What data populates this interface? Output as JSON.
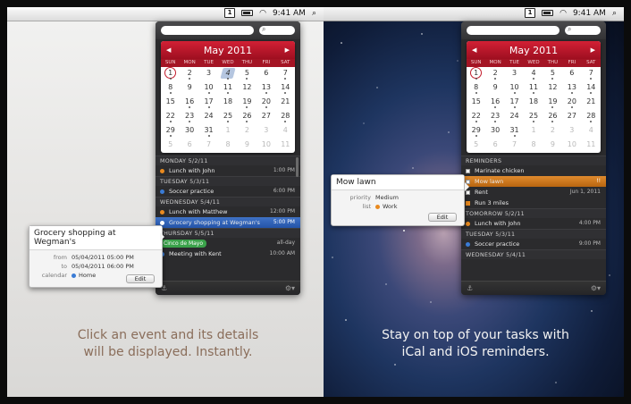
{
  "menubar": {
    "calendar_icon_text": "1",
    "time": "9:41 AM"
  },
  "calendar": {
    "month_title": "May 2011",
    "prev": "◀",
    "next": "▶",
    "weekdays": [
      "SUN",
      "MON",
      "TUE",
      "WED",
      "THU",
      "FRI",
      "SAT"
    ],
    "days": [
      "1",
      "2",
      "3",
      "4",
      "5",
      "6",
      "7",
      "8",
      "9",
      "10",
      "11",
      "12",
      "13",
      "14",
      "15",
      "16",
      "17",
      "18",
      "19",
      "20",
      "21",
      "22",
      "23",
      "24",
      "25",
      "26",
      "27",
      "28",
      "29",
      "30",
      "31",
      "1",
      "2",
      "3",
      "4",
      "5",
      "6",
      "7",
      "8",
      "9",
      "10",
      "11"
    ]
  },
  "left": {
    "agenda": {
      "monday_header": "MONDAY 5/2/11",
      "lunch_john": "Lunch with John",
      "lunch_john_time": "1:00 PM",
      "tuesday_header": "TUESDAY 5/3/11",
      "soccer": "Soccer practice",
      "soccer_time": "6:00 PM",
      "wednesday_header": "WEDNESDAY 5/4/11",
      "lunch_matthew": "Lunch with Matthew",
      "lunch_matthew_time": "12:00 PM",
      "grocery": "Grocery shopping at Wegman's",
      "grocery_time": "5:00 PM",
      "thursday_header": "THURSDAY 5/5/11",
      "cinco": "Cinco de Mayo",
      "cinco_time": "all-day",
      "meeting_kent": "Meeting with Kent",
      "meeting_kent_time": "10:00 AM"
    },
    "popup": {
      "title": "Grocery shopping at Wegman's",
      "from_label": "from",
      "from_value": "05/04/2011 05:00 PM",
      "to_label": "to",
      "to_value": "05/04/2011 06:00 PM",
      "calendar_label": "calendar",
      "calendar_value": "Home",
      "edit": "Edit"
    },
    "caption_line1": "Click an event and its details",
    "caption_line2": "will be displayed. Instantly."
  },
  "right": {
    "agenda": {
      "reminders_header": "REMINDERS",
      "marinate": "Marinate chicken",
      "mow": "Mow lawn",
      "mow_flag": "!!",
      "rent": "Rent",
      "rent_date": "Jun 1, 2011",
      "run": "Run 3 miles",
      "tomorrow_header": "TOMORROW 5/2/11",
      "lunch_john": "Lunch with John",
      "lunch_john_time": "4:00 PM",
      "tuesday_header": "TUESDAY 5/3/11",
      "soccer": "Soccer practice",
      "soccer_time": "9:00 PM",
      "wednesday_header": "WEDNESDAY 5/4/11"
    },
    "popup": {
      "title": "Mow lawn",
      "priority_label": "priority",
      "priority_value": "Medium",
      "list_label": "list",
      "list_value": "Work",
      "edit": "Edit"
    },
    "caption_line1": "Stay on top of your tasks with",
    "caption_line2": "iCal and iOS reminders."
  },
  "colors": {
    "red_header": "#c51a2e",
    "blue_dot": "#3a7bd5",
    "orange_dot": "#e98a1f",
    "green_pill": "#3aa24a",
    "selection_blue": "#2f62bb",
    "selection_orange": "#d27a20"
  }
}
